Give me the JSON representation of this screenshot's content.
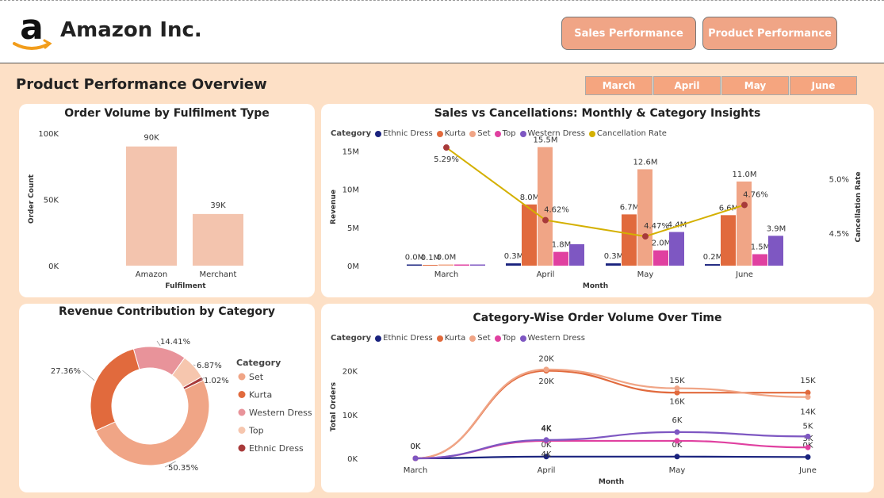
{
  "header": {
    "app_title": "Amazon Inc.",
    "nav": [
      "Sales Performance",
      "Product Performance"
    ]
  },
  "page_title": "Product Performance Overview",
  "month_filters": [
    "March",
    "April",
    "May",
    "June"
  ],
  "colors": {
    "ethnic_dress": "#1a237e",
    "kurta": "#e16a3d",
    "set": "#f0a586",
    "top": "#e040a0",
    "western_dress": "#7e57c2",
    "cancellation_rate": "#d4b000"
  },
  "chart_data": [
    {
      "type": "bar",
      "title": "Order Volume by Fulfilment Type",
      "categories": [
        "Amazon",
        "Merchant"
      ],
      "values": [
        90000,
        39000
      ],
      "data_labels": [
        "90K",
        "39K"
      ],
      "xlabel": "Fulfilment",
      "ylabel": "Order Count",
      "yticks": [
        "0K",
        "50K",
        "100K"
      ],
      "ylim": [
        0,
        100000
      ]
    },
    {
      "type": "bar",
      "title": "Sales vs Cancellations: Monthly & Category Insights",
      "legend_title": "Category",
      "legend": [
        "Ethnic Dress",
        "Kurta",
        "Set",
        "Top",
        "Western Dress",
        "Cancellation Rate"
      ],
      "categories": [
        "March",
        "April",
        "May",
        "June"
      ],
      "xlabel": "Month",
      "ylabel": "Revenue",
      "y2label": "Cancellation Rate",
      "yticks": [
        "0M",
        "5M",
        "10M",
        "15M"
      ],
      "y2ticks": [
        "4.5%",
        "5.0%"
      ],
      "ylim": [
        0,
        17
      ],
      "series": [
        {
          "name": "Ethnic Dress",
          "values": [
            0.0,
            0.3,
            0.3,
            0.2
          ],
          "labels": [
            "0.0M",
            "0.3M",
            "0.3M",
            "0.2M"
          ]
        },
        {
          "name": "Kurta",
          "values": [
            0.1,
            8.0,
            6.7,
            6.6
          ],
          "labels": [
            "0.1M",
            "8.0M",
            "6.7M",
            "6.6M"
          ]
        },
        {
          "name": "Set",
          "values": [
            0.0,
            15.5,
            12.6,
            11.0
          ],
          "labels": [
            "0.0M",
            "15.5M",
            "12.6M",
            "11.0M"
          ]
        },
        {
          "name": "Top",
          "values": [
            0.0,
            1.8,
            2.0,
            1.5
          ],
          "labels": [
            "",
            "1.8M",
            "2.0M",
            "1.5M"
          ]
        },
        {
          "name": "Western Dress",
          "values": [
            0.0,
            2.8,
            4.4,
            3.9
          ],
          "labels": [
            "",
            "",
            "4.4M",
            "3.9M"
          ]
        }
      ],
      "line": {
        "name": "Cancellation Rate",
        "values": [
          5.29,
          4.62,
          4.47,
          4.76
        ],
        "labels": [
          "5.29%",
          "4.62%",
          "4.47%",
          "4.76%"
        ],
        "ylim": [
          4.2,
          5.4
        ]
      }
    },
    {
      "type": "pie",
      "title": "Revenue Contribution by Category",
      "legend_title": "Category",
      "legend": [
        "Set",
        "Kurta",
        "Western Dress",
        "Top",
        "Ethnic Dress"
      ],
      "slices": [
        {
          "name": "Set",
          "value": 50.35,
          "label": "50.35%",
          "color": "#f0a586"
        },
        {
          "name": "Kurta",
          "value": 27.36,
          "label": "27.36%",
          "color": "#e16a3d"
        },
        {
          "name": "Western Dress",
          "value": 14.41,
          "label": "14.41%",
          "color": "#e8939a"
        },
        {
          "name": "Top",
          "value": 6.87,
          "label": "6.87%",
          "color": "#f6c6ae"
        },
        {
          "name": "Ethnic Dress",
          "value": 1.02,
          "label": "1.02%",
          "color": "#a83a3a"
        }
      ]
    },
    {
      "type": "line",
      "title": "Category-Wise Order Volume Over Time",
      "legend_title": "Category",
      "legend": [
        "Ethnic Dress",
        "Kurta",
        "Set",
        "Top",
        "Western Dress"
      ],
      "categories": [
        "March",
        "April",
        "May",
        "June"
      ],
      "xlabel": "Month",
      "ylabel": "Total Orders",
      "yticks": [
        "0K",
        "10K",
        "20K"
      ],
      "ylim": [
        0,
        23000
      ],
      "series": [
        {
          "name": "Ethnic Dress",
          "values": [
            0,
            400,
            400,
            300
          ],
          "labels": [
            "0K",
            "0K",
            "0K",
            "0K"
          ]
        },
        {
          "name": "Kurta",
          "values": [
            0,
            20000,
            15000,
            15000
          ],
          "labels": [
            "",
            "20K",
            "15K",
            "15K"
          ]
        },
        {
          "name": "Set",
          "values": [
            0,
            20300,
            16000,
            14000
          ],
          "labels": [
            "0K",
            "20K",
            "16K",
            "14K"
          ]
        },
        {
          "name": "Top",
          "values": [
            0,
            4000,
            4000,
            2500
          ],
          "labels": [
            "",
            "4K",
            "",
            "3K"
          ]
        },
        {
          "name": "Western Dress",
          "values": [
            0,
            4200,
            6000,
            5000
          ],
          "labels": [
            "",
            "4K",
            "6K",
            "5K"
          ]
        }
      ],
      "extra_labels": [
        "4K"
      ]
    }
  ]
}
